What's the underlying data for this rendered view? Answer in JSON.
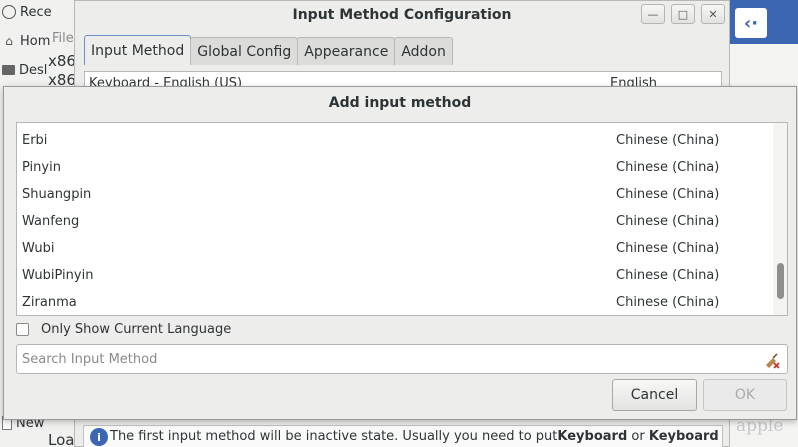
{
  "background": {
    "file_manager": {
      "sidebar_items": [
        {
          "label": "Rece",
          "icon": "recent-icon"
        },
        {
          "label": "Hom",
          "icon": "home-icon"
        },
        {
          "label": "Desl",
          "icon": "desktop-icon"
        }
      ],
      "file_tab": "File",
      "entries": [
        "x86",
        "x86"
      ],
      "bottom_items": [
        "New",
        "Loa"
      ]
    },
    "watermark_right": "apple"
  },
  "config_window": {
    "title": "Input Method Configuration",
    "tabs": [
      "Input Method",
      "Global Config",
      "Appearance",
      "Addon"
    ],
    "active_tab": 0,
    "list_first_row": {
      "name": "Keyboard - English (US)",
      "lang": "English"
    },
    "info_note": {
      "prefix": "The first input method will be inactive state. Usually you need to put ",
      "bold1": "Keyboard",
      "middle": " or ",
      "bold2": "Keyboard"
    }
  },
  "dialog": {
    "title": "Add input method",
    "items": [
      {
        "name": "Erbi",
        "lang": "Chinese (China)"
      },
      {
        "name": "Pinyin",
        "lang": "Chinese (China)"
      },
      {
        "name": "Shuangpin",
        "lang": "Chinese (China)"
      },
      {
        "name": "Wanfeng",
        "lang": "Chinese (China)"
      },
      {
        "name": "Wubi",
        "lang": "Chinese (China)"
      },
      {
        "name": "WubiPinyin",
        "lang": "Chinese (China)"
      },
      {
        "name": "Ziranma",
        "lang": "Chinese (China)"
      }
    ],
    "only_current_label": "Only Show Current Language",
    "only_current_checked": false,
    "search_placeholder": "Search Input Method",
    "search_value": "",
    "cancel_label": "Cancel",
    "ok_label": "OK",
    "ok_enabled": false,
    "scroll_position": 0.92
  }
}
